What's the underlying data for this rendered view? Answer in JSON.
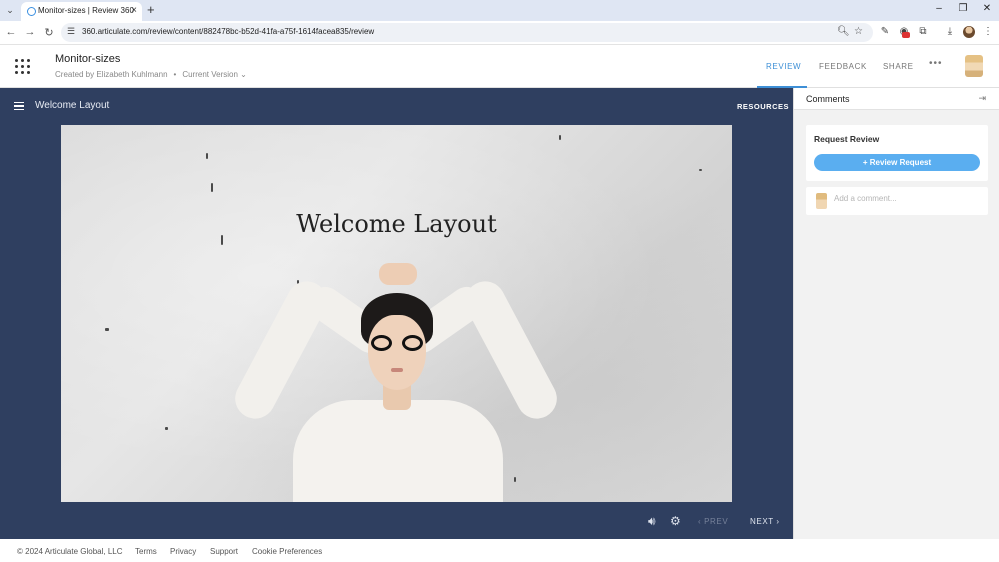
{
  "browser": {
    "tab_title": "Monitor-sizes | Review 360",
    "url": "360.articulate.com/review/content/882478bc-b52d-41fa-a75f-1614facea835/review",
    "new_tab_symbol": "+",
    "close_symbol": "×"
  },
  "header": {
    "project_title": "Monitor-sizes",
    "created_by": "Created by Elizabeth Kuhlmann",
    "separator": "•",
    "version": "Current Version",
    "tabs": [
      "REVIEW",
      "FEEDBACK",
      "SHARE"
    ],
    "active_tab": "REVIEW",
    "more": "•••"
  },
  "player": {
    "slide_name": "Welcome Layout",
    "resources_label": "RESOURCES",
    "slide_title": "Welcome Layout",
    "prev_label": "PREV",
    "next_label": "NEXT"
  },
  "comments": {
    "title": "Comments",
    "review_heading": "Request Review",
    "review_button": "+ Review Request",
    "comment_placeholder": "Add a comment..."
  },
  "footer": {
    "copyright": "© 2024 Articulate Global, LLC",
    "links": [
      "Terms",
      "Privacy",
      "Support",
      "Cookie Preferences"
    ]
  },
  "colors": {
    "player_bg": "#2f3f60",
    "accent": "#3d8fd6",
    "button": "#5aaef0"
  }
}
